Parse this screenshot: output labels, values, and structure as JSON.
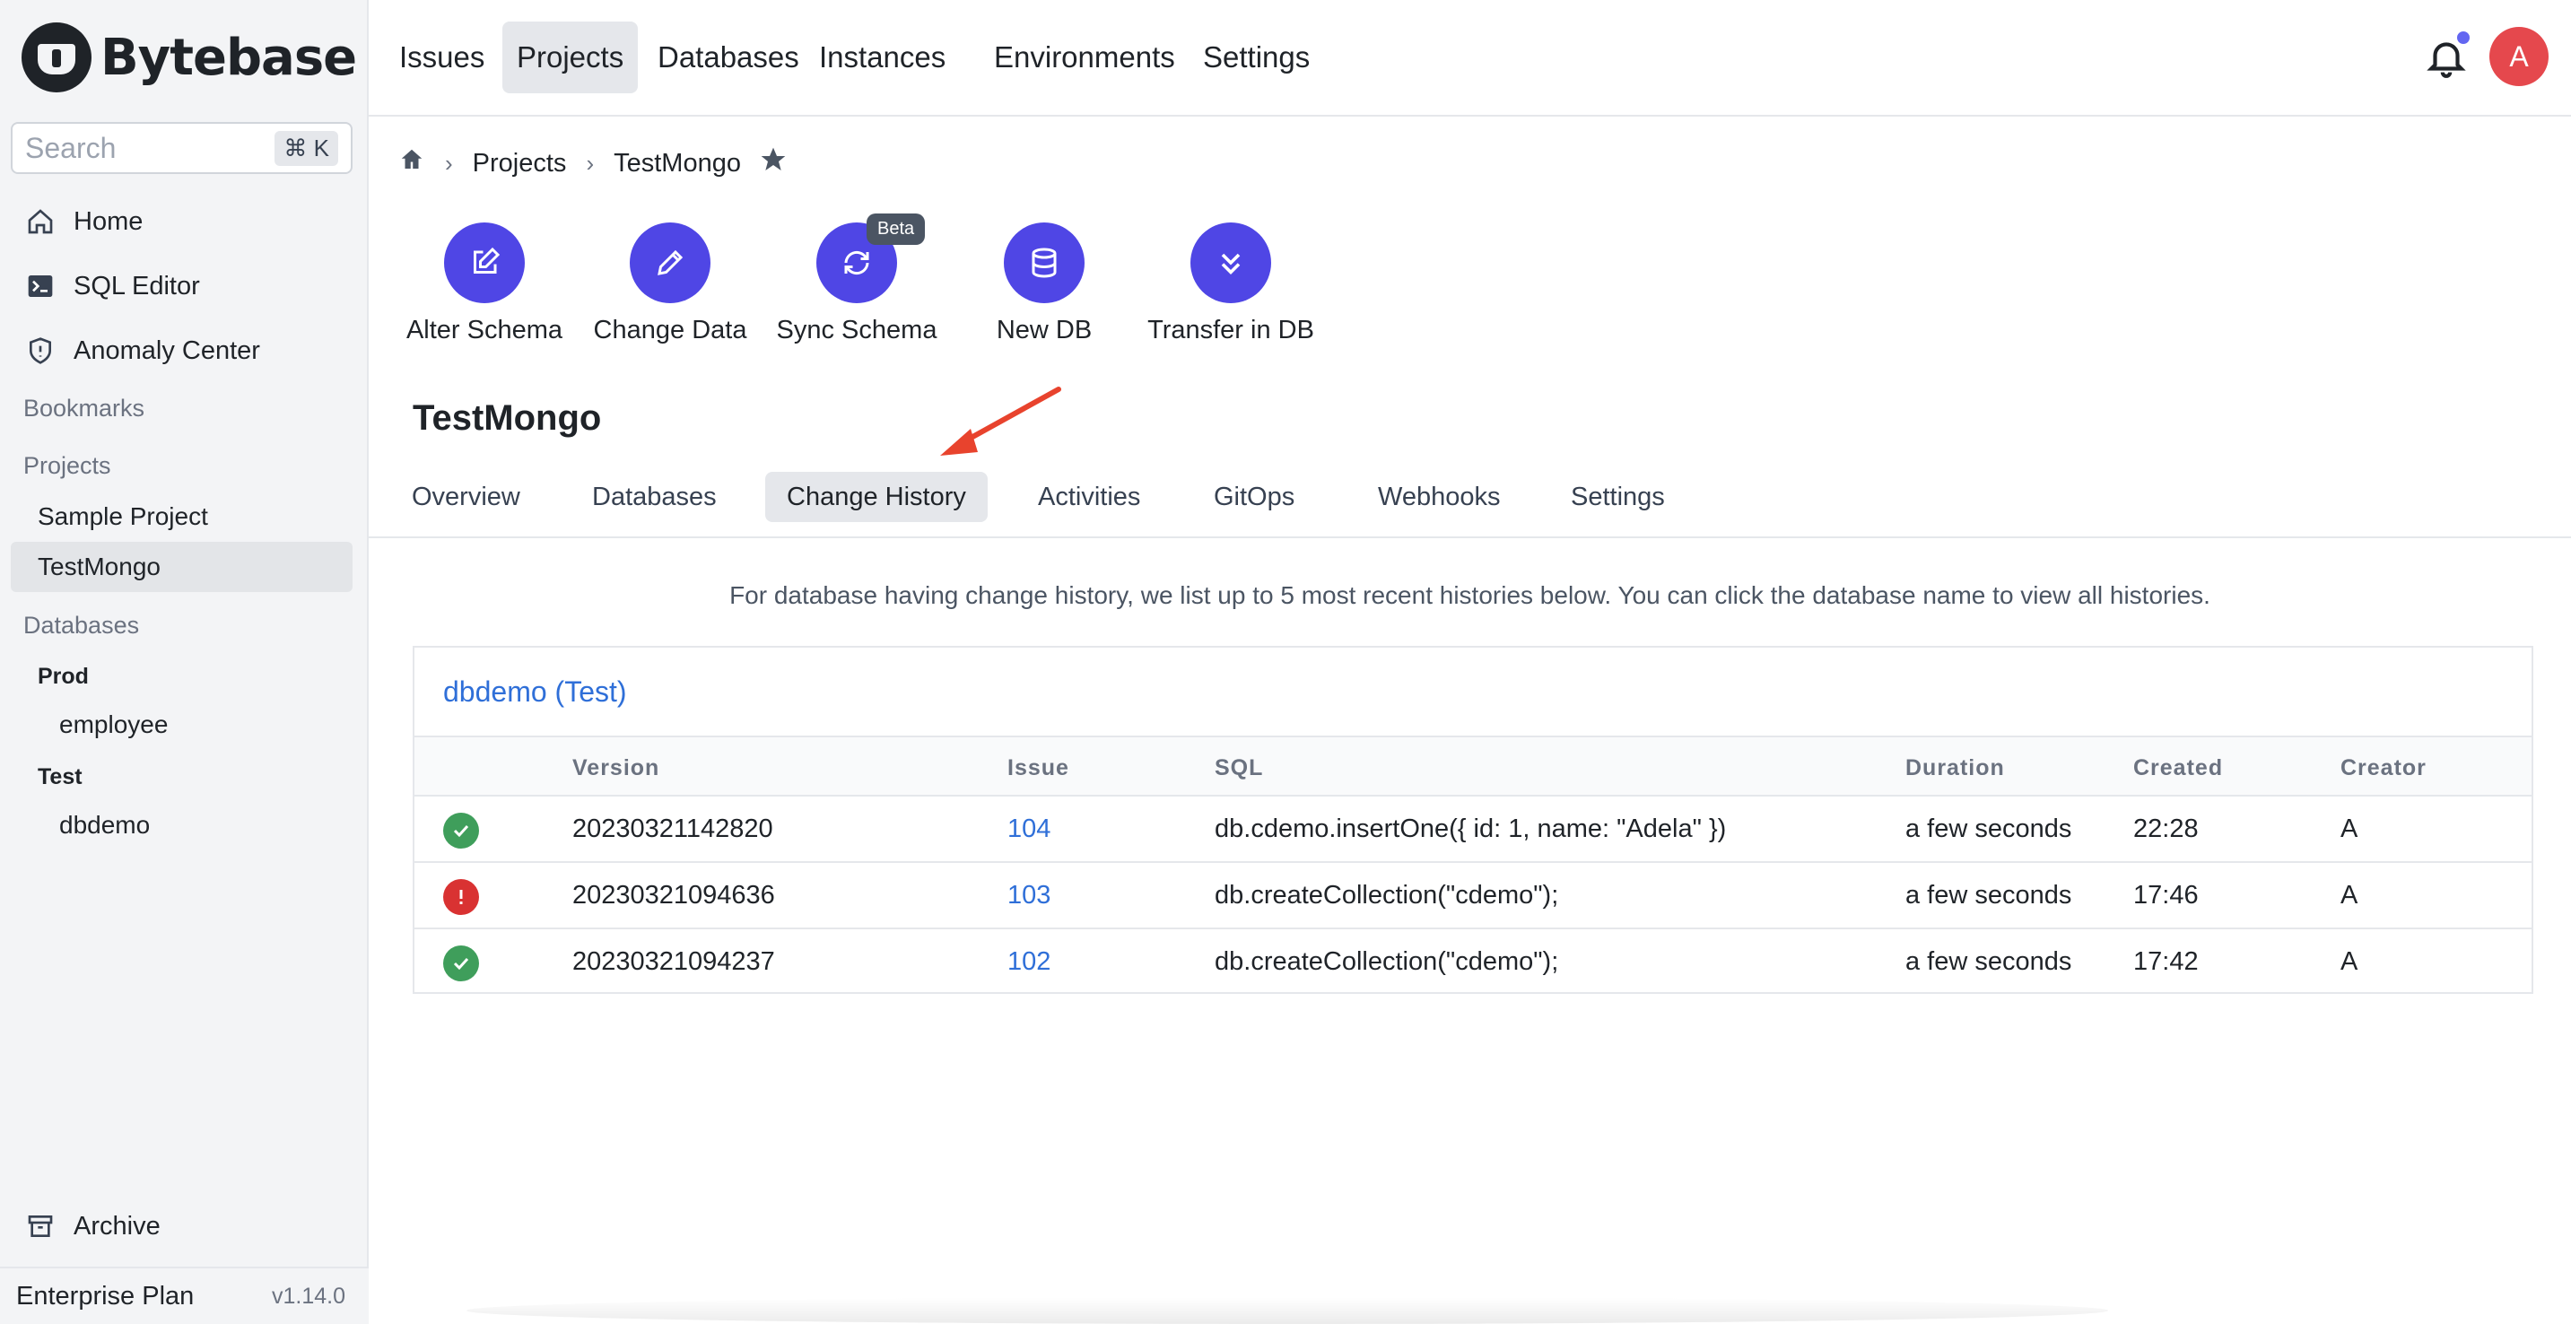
{
  "app": {
    "logo_text": "Bytebase"
  },
  "sidebar": {
    "search_placeholder": "Search",
    "search_shortcut": "⌘ K",
    "nav": [
      {
        "label": "Home",
        "icon": "home-icon"
      },
      {
        "label": "SQL Editor",
        "icon": "terminal-icon"
      },
      {
        "label": "Anomaly Center",
        "icon": "shield-icon"
      }
    ],
    "bookmarks_label": "Bookmarks",
    "projects_label": "Projects",
    "projects": [
      "Sample Project",
      "TestMongo"
    ],
    "databases_label": "Databases",
    "environments": [
      {
        "name": "Prod",
        "databases": [
          "employee"
        ]
      },
      {
        "name": "Test",
        "databases": [
          "dbdemo"
        ]
      }
    ],
    "archive_label": "Archive",
    "plan_name": "Enterprise Plan",
    "version": "v1.14.0"
  },
  "topnav": {
    "items": [
      "Issues",
      "Projects",
      "Databases",
      "Instances",
      "Environments",
      "Settings"
    ],
    "active": "Projects",
    "avatar_initial": "A"
  },
  "breadcrumb": {
    "items": [
      "Projects",
      "TestMongo"
    ]
  },
  "quick_actions": [
    {
      "label": "Alter Schema",
      "icon": "edit-square-icon"
    },
    {
      "label": "Change Data",
      "icon": "pencil-icon"
    },
    {
      "label": "Sync Schema",
      "icon": "refresh-icon",
      "badge": "Beta"
    },
    {
      "label": "New DB",
      "icon": "database-icon"
    },
    {
      "label": "Transfer in DB",
      "icon": "chevrons-down-icon"
    }
  ],
  "project": {
    "title": "TestMongo"
  },
  "tabs": {
    "items": [
      "Overview",
      "Databases",
      "Change History",
      "Activities",
      "GitOps",
      "Webhooks",
      "Settings"
    ],
    "active": "Change History"
  },
  "info_text": "For database having change history, we list up to 5 most recent histories below. You can click the database name to view all histories.",
  "history": {
    "database_title": "dbdemo (Test)",
    "columns": [
      "Version",
      "Issue",
      "SQL",
      "Duration",
      "Created",
      "Creator"
    ],
    "rows": [
      {
        "status": "success",
        "version": "20230321142820",
        "issue": "104",
        "sql": "db.cdemo.insertOne({ id: 1, name: \"Adela\" })",
        "duration": "a few seconds",
        "created": "22:28",
        "creator": "A"
      },
      {
        "status": "failed",
        "version": "20230321094636",
        "issue": "103",
        "sql": "db.createCollection(\"cdemo\");",
        "duration": "a few seconds",
        "created": "17:46",
        "creator": "A"
      },
      {
        "status": "success",
        "version": "20230321094237",
        "issue": "102",
        "sql": "db.createCollection(\"cdemo\");",
        "duration": "a few seconds",
        "created": "17:42",
        "creator": "A"
      }
    ]
  },
  "colors": {
    "accent": "#4f46e5",
    "link": "#2f6fd8",
    "success": "#3f9e5b",
    "error": "#d93232",
    "annotation_arrow": "#e8432d"
  }
}
